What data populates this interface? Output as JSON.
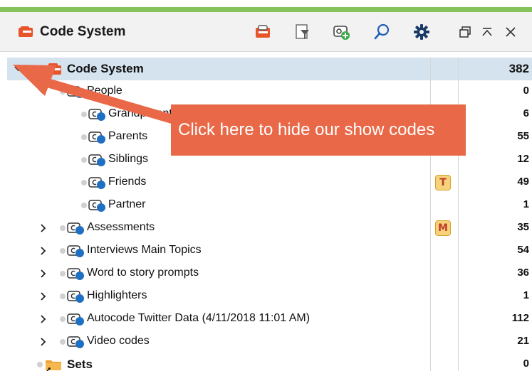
{
  "window": {
    "title": "Code System",
    "toolbar": [
      {
        "name": "code-system-icon-button"
      },
      {
        "name": "filter-icon-button"
      },
      {
        "name": "new-code-icon-button"
      },
      {
        "name": "search-icon-button"
      },
      {
        "name": "settings-icon-button"
      }
    ],
    "window_controls": [
      "undock",
      "collapse",
      "close"
    ]
  },
  "colors": {
    "accent_green": "#86c35a",
    "selected_row": "#d5e3ef",
    "callout": "#e96848",
    "code_icon_blue": "#1f6fc2",
    "code_system_orange": "#e8542b",
    "folder_orange": "#f0a33a"
  },
  "tree": {
    "rows": [
      {
        "label": "Code System",
        "count": "382",
        "icon": "code-system-icon",
        "expand": "expanded",
        "memo": ""
      },
      {
        "label": "People",
        "count": "0",
        "icon": "code-icon",
        "expand": "expanded",
        "memo": ""
      },
      {
        "label": "Grandparents",
        "count": "6",
        "icon": "code-icon",
        "expand": "none",
        "memo": ""
      },
      {
        "label": "Parents",
        "count": "55",
        "icon": "code-icon",
        "expand": "none",
        "memo": ""
      },
      {
        "label": "Siblings",
        "count": "12",
        "icon": "code-icon",
        "expand": "none",
        "memo": ""
      },
      {
        "label": "Friends",
        "count": "49",
        "icon": "code-icon",
        "expand": "none",
        "memo": "T"
      },
      {
        "label": "Partner",
        "count": "1",
        "icon": "code-icon",
        "expand": "none",
        "memo": ""
      },
      {
        "label": "Assessments",
        "count": "35",
        "icon": "code-icon",
        "expand": "collapsed",
        "memo": "M"
      },
      {
        "label": "Interviews Main Topics",
        "count": "54",
        "icon": "code-icon",
        "expand": "collapsed",
        "memo": ""
      },
      {
        "label": "Word to story prompts",
        "count": "36",
        "icon": "code-icon",
        "expand": "collapsed",
        "memo": ""
      },
      {
        "label": "Highlighters",
        "count": "1",
        "icon": "code-icon",
        "expand": "collapsed",
        "memo": ""
      },
      {
        "label": "Autocode Twitter Data (4/11/2018 11:01 AM)",
        "count": "112",
        "icon": "code-icon",
        "expand": "collapsed",
        "memo": ""
      },
      {
        "label": "Video codes",
        "count": "21",
        "icon": "code-icon",
        "expand": "collapsed",
        "memo": ""
      },
      {
        "label": "Sets",
        "count": "0",
        "icon": "sets-folder-icon",
        "expand": "none",
        "memo": ""
      }
    ]
  },
  "callout": {
    "text": "Click here to hide our show codes"
  }
}
